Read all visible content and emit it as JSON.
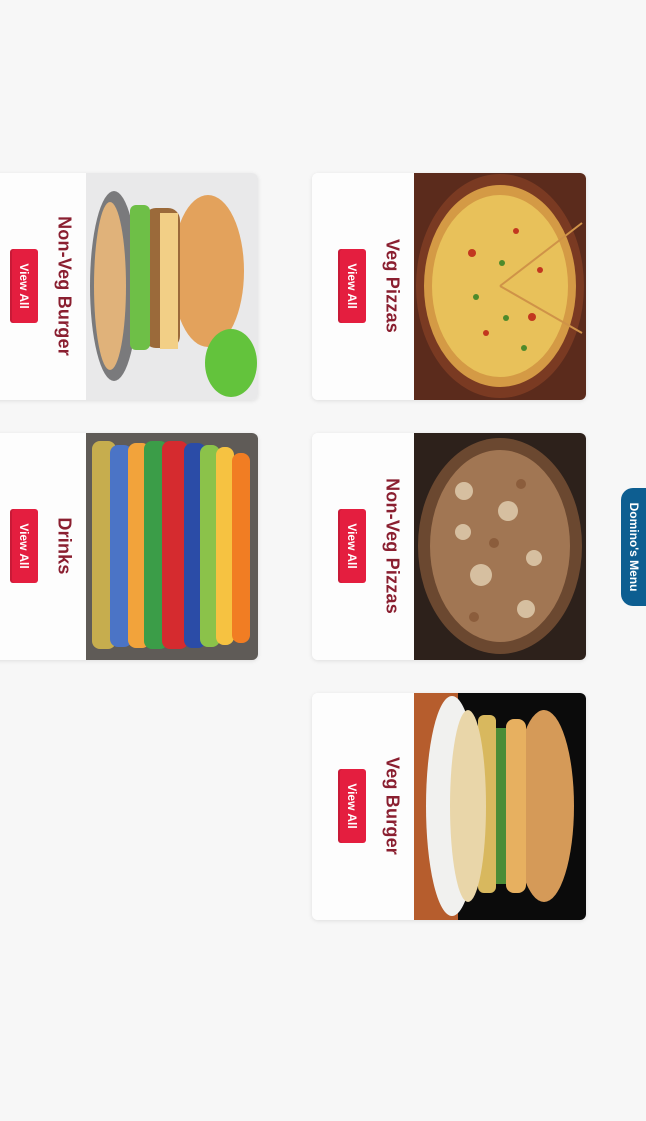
{
  "categories": [
    {
      "title": "Veg Pizzas",
      "button_label": "View All",
      "image_icon": "veg-pizza-image"
    },
    {
      "title": "Non-Veg Pizzas",
      "button_label": "View All",
      "image_icon": "non-veg-pizza-image"
    },
    {
      "title": "Veg Burger",
      "button_label": "View All",
      "image_icon": "veg-burger-image"
    },
    {
      "title": "Non-Veg Burger",
      "button_label": "View All",
      "image_icon": "non-veg-burger-image"
    },
    {
      "title": "Drinks",
      "button_label": "View All",
      "image_icon": "drinks-image"
    }
  ],
  "side_tab": {
    "label": "Domino's Menu",
    "color": "#0d5e91"
  },
  "colors": {
    "accent_red": "#e41e3f",
    "title_maroon": "#8a1f30"
  }
}
